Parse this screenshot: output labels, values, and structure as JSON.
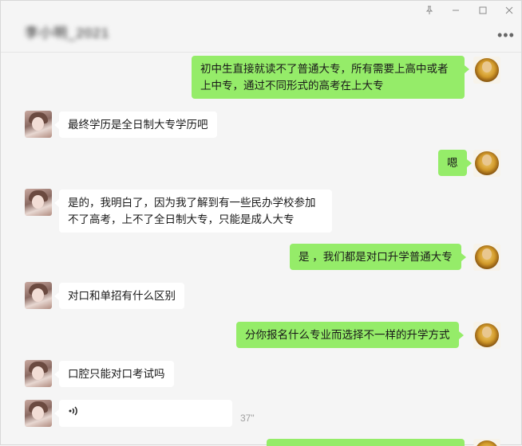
{
  "window": {
    "title": "李小明_2021",
    "controls": {
      "pin": "†",
      "minimize": "–",
      "maximize": "□",
      "close": "✕"
    },
    "more": "•••"
  },
  "messages": [
    {
      "side": "right",
      "text": "初中生直接就读不了普通大专，所有需要上高中或者上中专，通过不同形式的高考在上大专"
    },
    {
      "side": "left",
      "text": "最终学历是全日制大专学历吧"
    },
    {
      "side": "right",
      "text": "嗯"
    },
    {
      "side": "left",
      "text": "是的，我明白了，因为我了解到有一些民办学校参加不了高考，上不了全日制大专，只能是成人大专"
    },
    {
      "side": "right",
      "text": "是 ，我们都是对口升学普通大专"
    },
    {
      "side": "left",
      "text": "对口和单招有什么区别"
    },
    {
      "side": "right",
      "text": "分你报名什么专业而选择不一样的升学方式"
    },
    {
      "side": "left",
      "text": "口腔只能对口考试吗"
    },
    {
      "side": "left",
      "type": "voice",
      "icon": ")))",
      "duration": "37\""
    }
  ],
  "colors": {
    "outgoing": "#95ec69",
    "incoming": "#ffffff",
    "background": "#f5f5f5"
  }
}
